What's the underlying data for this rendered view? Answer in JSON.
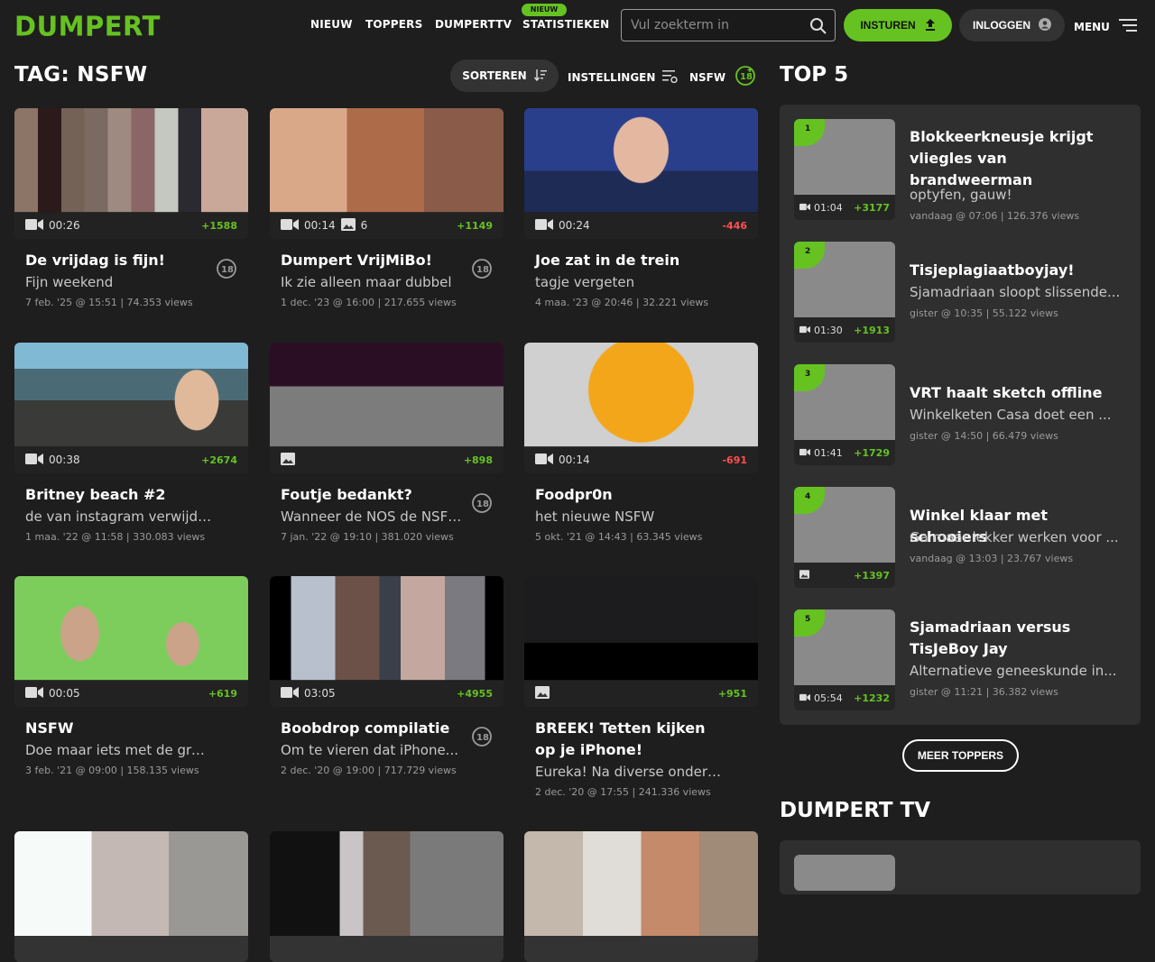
{
  "brand": {
    "logo": "DUMPERT",
    "accent": "#66c221",
    "negative": "#ff5050"
  },
  "nav": {
    "items": [
      "NIEUW",
      "TOPPERS",
      "DUMPERTTV",
      "STATISTIEKEN"
    ],
    "badge": "NIEUW",
    "search_placeholder": "Vul zoekterm in",
    "upload_label": "INSTUREN",
    "login_label": "INLOGGEN",
    "menu_label": "MENU"
  },
  "page": {
    "title": "TAG: NSFW",
    "sort_label": "SORTEREN",
    "settings_label": "INSTELLINGEN",
    "nsfw_label": "NSFW"
  },
  "cards": [
    {
      "title": "De vrijdag is fijn!",
      "desc": "Fijn weekend",
      "meta": "7 feb. '25 @ 15:51 | 74.353 views",
      "duration": "00:26",
      "score": "+1588",
      "type": "video",
      "nsfw": true
    },
    {
      "title": "Dumpert VrijMiBo!",
      "desc": "Ik zie alleen maar dubbel",
      "meta": "1 dec. '23 @ 16:00 | 217.655 views",
      "duration": "00:14",
      "photos": "6",
      "score": "+1149",
      "type": "video+photo",
      "nsfw": true
    },
    {
      "title": "Joe zat in de trein",
      "desc": "tagje vergeten",
      "meta": "4 maa. '23 @ 20:46 | 32.221 views",
      "duration": "00:24",
      "score": "-446",
      "type": "video",
      "nsfw": false
    },
    {
      "title": "Britney beach #2",
      "desc": "de van instagram verwijderde...",
      "meta": "1 maa. '22 @ 11:58 | 330.083 views",
      "duration": "00:38",
      "score": "+2674",
      "type": "video",
      "nsfw": false
    },
    {
      "title": "Foutje bedankt?",
      "desc": "Wanneer de NOS de NSFW...",
      "meta": "7 jan. '22 @ 19:10 | 381.020 views",
      "duration": "",
      "score": "+898",
      "type": "photo",
      "nsfw": true
    },
    {
      "title": "Foodpr0n",
      "desc": "het nieuwe NSFW",
      "meta": "5 okt. '21 @ 14:43 | 63.345 views",
      "duration": "00:14",
      "score": "-691",
      "type": "video",
      "nsfw": false
    },
    {
      "title": "NSFW",
      "desc": "Doe maar iets met de greenscreen",
      "meta": "3 feb. '21 @ 09:00 | 158.135 views",
      "duration": "00:05",
      "score": "+619",
      "type": "video",
      "nsfw": false
    },
    {
      "title": "Boobdrop compilatie",
      "desc": "Om te vieren dat iPhone...",
      "meta": "2 dec. '20 @ 19:00 | 717.729 views",
      "duration": "03:05",
      "score": "+4955",
      "type": "video",
      "nsfw": true
    },
    {
      "title": "BREEK! Tetten kijken op je iPhone!",
      "desc": "Eureka! Na diverse onderzoeken...",
      "meta": "2 dec. '20 @ 17:55 | 241.336 views",
      "duration": "",
      "score": "+951",
      "type": "photo",
      "nsfw": false
    }
  ],
  "sidebar": {
    "top_title": "TOP 5",
    "top": [
      {
        "rank": "1",
        "title": "Blokkeerkneusje krijgt vliegles van brandweerman",
        "desc": "optyfen, gauw!",
        "meta": "vandaag @ 07:06 | 126.376 views",
        "duration": "01:04",
        "score": "+3177",
        "type": "video"
      },
      {
        "rank": "2",
        "title": "Tisjeplagiaatboyjay!",
        "desc": "Sjamadriaan sloopt slissende...",
        "meta": "gister @ 10:35 | 55.122 views",
        "duration": "01:30",
        "score": "+1913",
        "type": "video"
      },
      {
        "rank": "3",
        "title": "VRT haalt sketch offline",
        "desc": "Winkelketen Casa doet een ...",
        "meta": "gister @ 14:50 | 66.479 views",
        "duration": "01:41",
        "score": "+1729",
        "type": "video"
      },
      {
        "rank": "4",
        "title": "Winkel klaar met schooiers",
        "desc": "Ga maar lekker werken voor ...",
        "meta": "vandaag @ 13:03 | 23.767 views",
        "duration": "",
        "score": "+1397",
        "type": "photo"
      },
      {
        "rank": "5",
        "title": "Sjamadriaan versus TisJeBoy Jay",
        "desc": "Alternatieve geneeskunde in...",
        "meta": "gister @ 11:21 | 36.382 views",
        "duration": "05:54",
        "score": "+1232",
        "type": "video"
      }
    ],
    "more_label": "MEER TOPPERS",
    "tv_title": "DUMPERT TV"
  }
}
